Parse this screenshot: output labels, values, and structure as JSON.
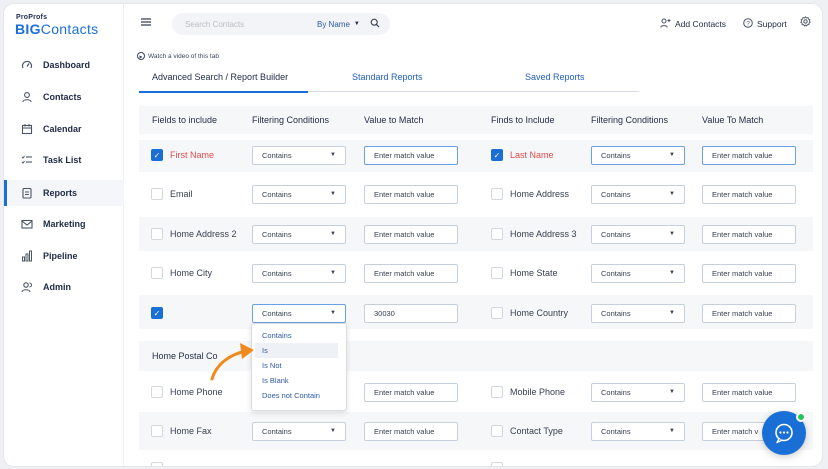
{
  "brand": {
    "top": "ProProfs",
    "main_bold": "BIG",
    "main_rest": "Contacts"
  },
  "sidebar": {
    "items": [
      {
        "label": "Dashboard",
        "icon": "speedometer-icon"
      },
      {
        "label": "Contacts",
        "icon": "person-icon"
      },
      {
        "label": "Calendar",
        "icon": "calendar-icon"
      },
      {
        "label": "Task List",
        "icon": "checklist-icon"
      },
      {
        "label": "Reports",
        "icon": "report-icon",
        "active": true
      },
      {
        "label": "Marketing",
        "icon": "mail-icon"
      },
      {
        "label": "Pipeline",
        "icon": "bar-chart-icon"
      },
      {
        "label": "Admin",
        "icon": "users-icon"
      }
    ]
  },
  "topbar": {
    "search_placeholder": "Search Contacts",
    "search_by": "By Name",
    "add_contacts": "Add Contacts",
    "support": "Support"
  },
  "content": {
    "watch_video": "Watch a video of this tab",
    "tabs": [
      "Advanced Search / Report Builder",
      "Standard Reports",
      "Saved Reports"
    ],
    "headers": {
      "left": [
        "Fields to include",
        "Filtering Conditions",
        "Value to Match"
      ],
      "right": [
        "Finds to Include",
        "Filtering Conditions",
        "Value To Match"
      ]
    },
    "rows": [
      {
        "left_label": "First Name",
        "left_checked": true,
        "left_red": true,
        "left_cond": "Contains",
        "left_value": "Enter match value",
        "right_label": "Last Name",
        "right_checked": true,
        "right_red": true,
        "right_cond": "Contains",
        "right_value": "Enter match value"
      },
      {
        "left_label": "Email",
        "left_cond": "Contains",
        "left_value": "Enter match value",
        "right_label": "Home Address",
        "right_cond": "Contains",
        "right_value": "Enter match value"
      },
      {
        "left_label": "Home Address 2",
        "left_cond": "Contains",
        "left_value": "Enter match value",
        "right_label": "Home Address 3",
        "right_cond": "Contains",
        "right_value": "Enter match value"
      },
      {
        "left_label": "Home City",
        "left_cond": "Contains",
        "left_value": "Enter match value",
        "right_label": "Home State",
        "right_cond": "Contains",
        "right_value": "Enter match value"
      },
      {
        "left_label": "",
        "left_checked": true,
        "left_cond": "Contains",
        "left_value": "30030",
        "right_label": "Home Country",
        "right_cond": "Contains",
        "right_value": "Enter match value"
      }
    ],
    "section_title": "Home Postal Co",
    "rows_after": [
      {
        "left_label": "Home Phone",
        "left_value": "Enter match value",
        "right_label": "Mobile Phone",
        "right_cond": "Contains",
        "right_value": "Enter match value"
      },
      {
        "left_label": "Home Fax",
        "left_cond": "Contains",
        "left_value": "Enter match value",
        "right_label": "Contact Type",
        "right_cond": "Contains",
        "right_value": "Enter match v"
      }
    ],
    "dropdown_options": [
      "Contains",
      "Is",
      "Is Not",
      "Is Blank",
      "Does not Contain"
    ],
    "dropdown_highlighted": "Is"
  },
  "colors": {
    "accent": "#1a6fd6",
    "arrow": "#f08a1c",
    "required": "#e04b4b",
    "online": "#22c55e"
  }
}
